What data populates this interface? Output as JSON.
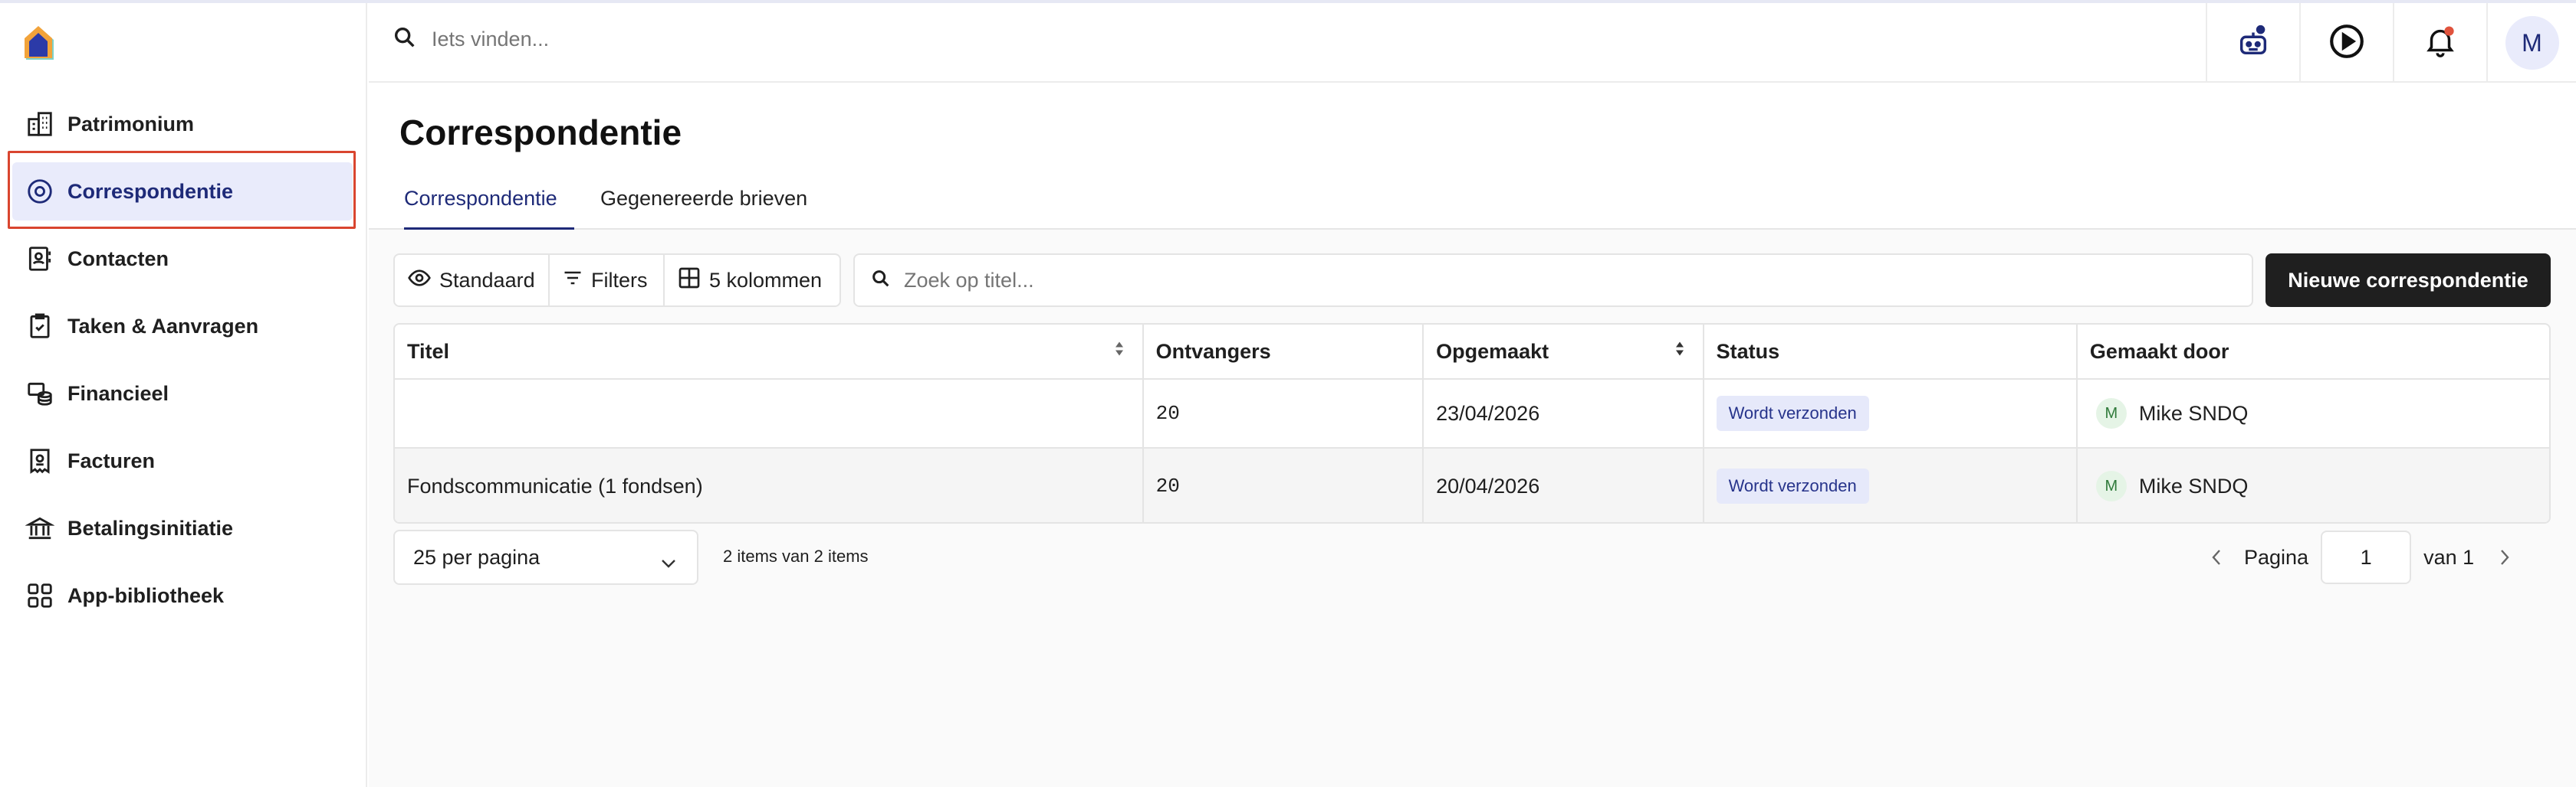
{
  "search": {
    "placeholder": "Iets vinden..."
  },
  "sidebar": {
    "items": [
      {
        "label": "Patrimonium",
        "icon": "building-icon"
      },
      {
        "label": "Correspondentie",
        "icon": "radio-circle-icon"
      },
      {
        "label": "Contacten",
        "icon": "contact-book-icon"
      },
      {
        "label": "Taken & Aanvragen",
        "icon": "clipboard-check-icon"
      },
      {
        "label": "Financieel",
        "icon": "coins-icon"
      },
      {
        "label": "Facturen",
        "icon": "invoice-icon"
      },
      {
        "label": "Betalingsinitiatie",
        "icon": "bank-icon"
      },
      {
        "label": "App-bibliotheek",
        "icon": "grid-icon"
      }
    ]
  },
  "header": {
    "avatar_initial": "M"
  },
  "page": {
    "title": "Correspondentie",
    "tabs": [
      {
        "label": "Correspondentie"
      },
      {
        "label": "Gegenereerde brieven"
      }
    ]
  },
  "toolbar": {
    "view_label": "Standaard",
    "filters_label": "Filters",
    "columns_label": "5 kolommen",
    "search_placeholder": "Zoek op titel...",
    "new_label": "Nieuwe correspondentie"
  },
  "table": {
    "columns": [
      "Titel",
      "Ontvangers",
      "Opgemaakt",
      "Status",
      "Gemaakt door"
    ],
    "rows": [
      {
        "title": "",
        "recipients": "20",
        "created": "23/04/2026",
        "status": "Wordt verzonden",
        "author_initial": "M",
        "author": "Mike SNDQ"
      },
      {
        "title": "Fondscommunicatie (1 fondsen)",
        "recipients": "20",
        "created": "20/04/2026",
        "status": "Wordt verzonden",
        "author_initial": "M",
        "author": "Mike SNDQ"
      }
    ]
  },
  "pagination": {
    "per_page": "25 per pagina",
    "items_count": "2 items van 2 items",
    "page_label": "Pagina",
    "page_value": "1",
    "of_label": "van 1"
  },
  "colors": {
    "accent": "#1e2a78",
    "active_bg": "#e9ebfb",
    "highlight": "#d9452f",
    "notification": "#e0533d"
  }
}
